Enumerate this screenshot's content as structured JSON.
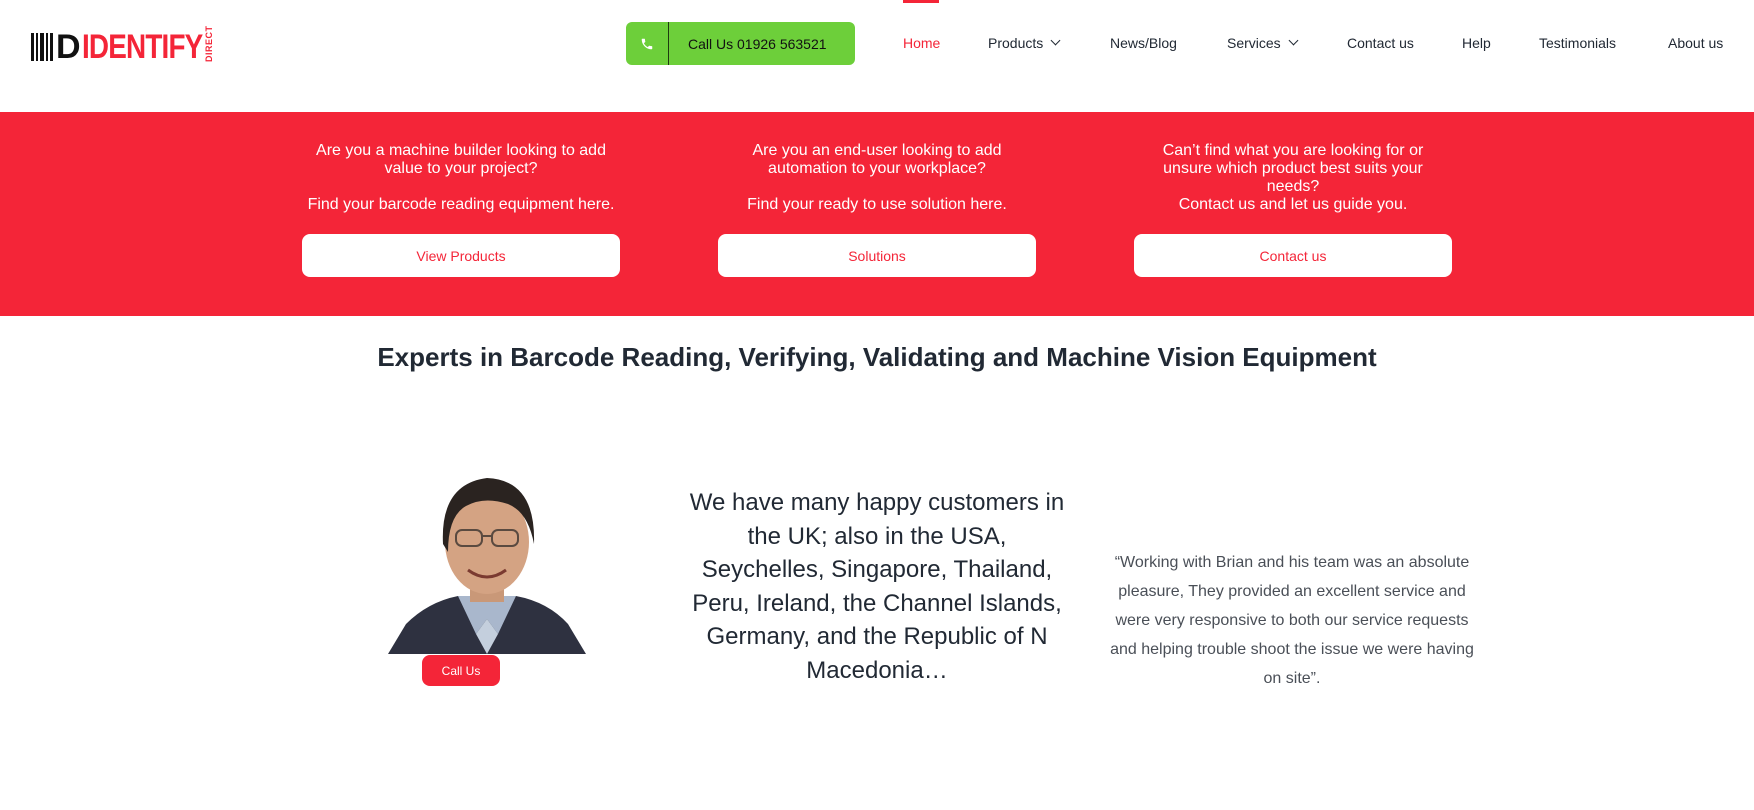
{
  "header": {
    "logo": {
      "prefix": "D",
      "name": "IDENTIFY",
      "sub": "DIRECT"
    },
    "call_button": {
      "icon": "phone-icon",
      "label": "Call Us 01926 563521"
    },
    "nav": [
      {
        "label": "Home",
        "active": true,
        "dropdown": false
      },
      {
        "label": "Products",
        "active": false,
        "dropdown": true
      },
      {
        "label": "News/Blog",
        "active": false,
        "dropdown": false
      },
      {
        "label": "Services",
        "active": false,
        "dropdown": true
      },
      {
        "label": "Contact us",
        "active": false,
        "dropdown": false
      },
      {
        "label": "Help",
        "active": false,
        "dropdown": false
      },
      {
        "label": "Testimonials",
        "active": false,
        "dropdown": false
      },
      {
        "label": "About us",
        "active": false,
        "dropdown": false
      }
    ]
  },
  "band": {
    "columns": [
      {
        "question": "Are you a machine builder looking to add value to your project?",
        "statement": "Find your barcode reading equipment here.",
        "button": "View Products"
      },
      {
        "question": "Are you an end-user looking to add automation to your workplace?",
        "statement": "Find your ready to use solution here.",
        "button": "Solutions"
      },
      {
        "question": "Can’t find what you are looking for or unsure which product best suits your needs?",
        "statement": "Contact us and let us guide you.",
        "button": "Contact us"
      }
    ]
  },
  "headline": "Experts in Barcode Reading, Verifying, Validating and Machine Vision Equipment",
  "contact_card": {
    "button": "Call Us"
  },
  "customers_text": "We have many happy customers in the UK; also in the USA, Seychelles, Singapore, Thailand, Peru, Ireland, the Channel Islands, Germany, and the Republic of N Macedonia…",
  "testimonial": "“Working with Brian and his team was an absolute pleasure, They provided an excellent service and were very responsive to both our service requests and helping trouble shoot the issue we were having on site”.",
  "colors": {
    "brand_red": "#f42538",
    "call_green": "#6dcf3a",
    "text": "#212934"
  }
}
